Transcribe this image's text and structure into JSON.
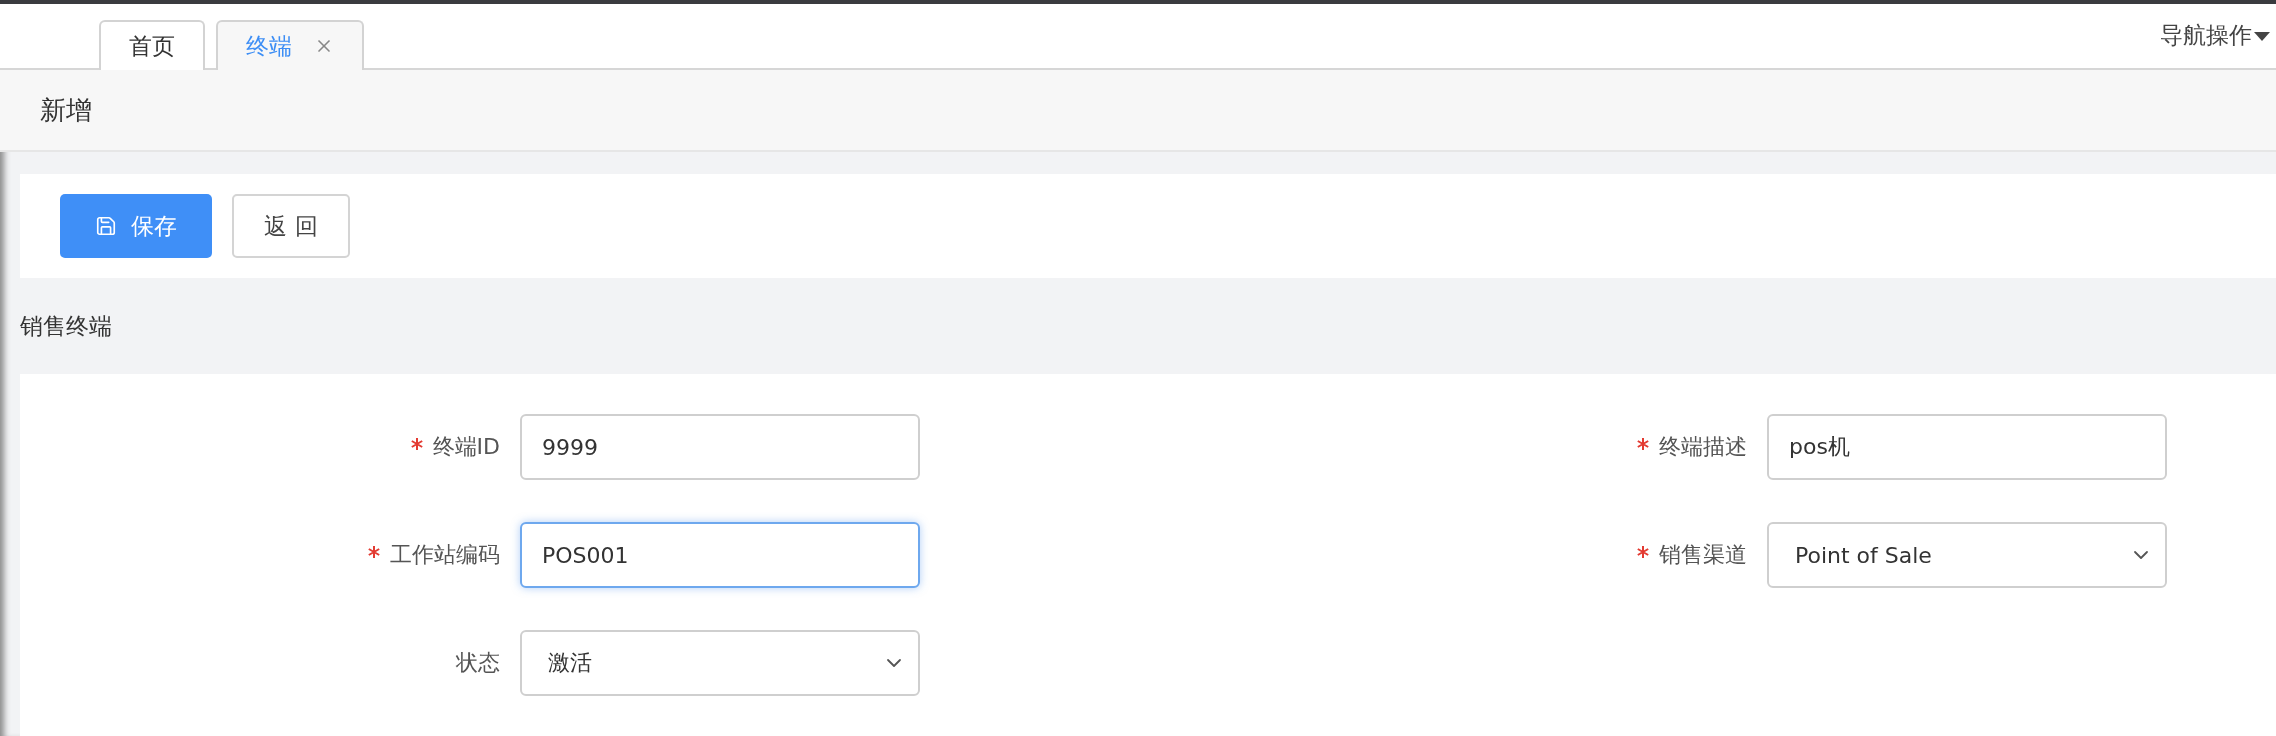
{
  "tabs": [
    {
      "label": "首页",
      "selected": false,
      "closable": false
    },
    {
      "label": "终端",
      "selected": true,
      "closable": true
    }
  ],
  "nav_menu": {
    "label": "导航操作"
  },
  "page_title": "新增",
  "toolbar": [
    {
      "label": "保存",
      "kind": "primary"
    },
    {
      "label": "返 回",
      "kind": "default"
    }
  ],
  "section_title": "销售终端",
  "fields": [
    {
      "label": "终端ID",
      "required": true,
      "kind": "input",
      "value": "9999",
      "focused": false
    },
    {
      "label": "终端描述",
      "required": true,
      "kind": "input",
      "value": "pos机",
      "focused": false
    },
    {
      "label": "工作站编码",
      "required": true,
      "kind": "input",
      "value": "POS001",
      "focused": true
    },
    {
      "label": "销售渠道",
      "required": true,
      "kind": "select",
      "value": "Point of Sale",
      "focused": false
    },
    {
      "label": "状态",
      "required": false,
      "kind": "select",
      "value": "激活",
      "focused": false
    }
  ]
}
